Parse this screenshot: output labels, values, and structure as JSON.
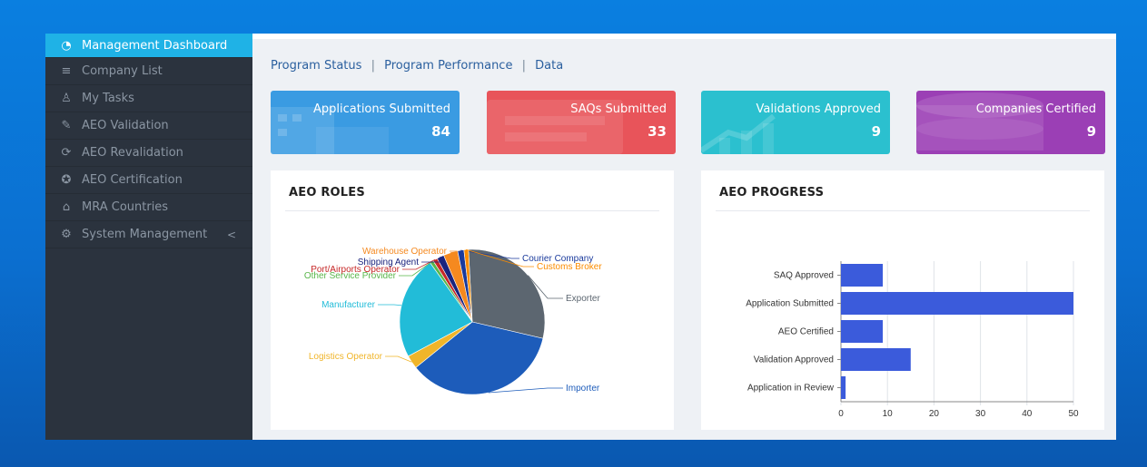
{
  "sidebar": {
    "items": [
      {
        "label": "Management Dashboard",
        "icon": "dashboard-icon",
        "active": true
      },
      {
        "label": "Company List",
        "icon": "list-icon"
      },
      {
        "label": "My Tasks",
        "icon": "user-icon"
      },
      {
        "label": "AEO Validation",
        "icon": "edit-icon"
      },
      {
        "label": "AEO Revalidation",
        "icon": "refresh-icon"
      },
      {
        "label": "AEO Certification",
        "icon": "certificate-icon"
      },
      {
        "label": "MRA Countries",
        "icon": "home-icon"
      },
      {
        "label": "System Management",
        "icon": "gear-icon",
        "chevron": "<"
      }
    ]
  },
  "tabs": {
    "program_status": "Program Status",
    "program_performance": "Program Performance",
    "data": "Data",
    "separator": "|"
  },
  "cards": [
    {
      "label": "Applications Submitted",
      "value": "84",
      "color": "#3a9be2"
    },
    {
      "label": "SAQs Submitted",
      "value": "33",
      "color": "#e8545a"
    },
    {
      "label": "Validations Approved",
      "value": "9",
      "color": "#2bc0cf"
    },
    {
      "label": "Companies Certified",
      "value": "9",
      "color": "#9b3fb5"
    }
  ],
  "panels": {
    "roles_title": "AEO ROLES",
    "progress_title": "AEO PROGRESS"
  },
  "chart_data": [
    {
      "type": "pie",
      "title": "AEO ROLES",
      "slices": [
        {
          "label": "Exporter",
          "value": 29.5,
          "color": "#5c6670"
        },
        {
          "label": "Importer",
          "value": 35.5,
          "color": "#1d5cba"
        },
        {
          "label": "Logistics Operator",
          "value": 3.0,
          "color": "#f0b52a"
        },
        {
          "label": "Manufacturer",
          "value": 23.0,
          "color": "#22bcd8"
        },
        {
          "label": "Other Service Provider",
          "value": 0.8,
          "color": "#59b64a"
        },
        {
          "label": "Port/Airports Operator",
          "value": 1.0,
          "color": "#c62828"
        },
        {
          "label": "Shipping Agent",
          "value": 1.6,
          "color": "#1a237e"
        },
        {
          "label": "Warehouse Operator",
          "value": 3.2,
          "color": "#f5891f"
        },
        {
          "label": "Courier Company",
          "value": 1.4,
          "color": "#1a3a9c"
        },
        {
          "label": "Customs Broker",
          "value": 1.0,
          "color": "#fb8c00"
        }
      ]
    },
    {
      "type": "bar",
      "orientation": "horizontal",
      "title": "AEO PROGRESS",
      "categories": [
        "SAQ Approved",
        "Application Submitted",
        "AEO Certified",
        "Validation Approved",
        "Application in Review"
      ],
      "values": [
        9,
        50,
        9,
        15,
        1
      ],
      "xlim": [
        0,
        50
      ],
      "xticks": [
        0,
        10,
        20,
        30,
        40,
        50
      ],
      "grid": true,
      "color": "#3b5bdb"
    }
  ]
}
